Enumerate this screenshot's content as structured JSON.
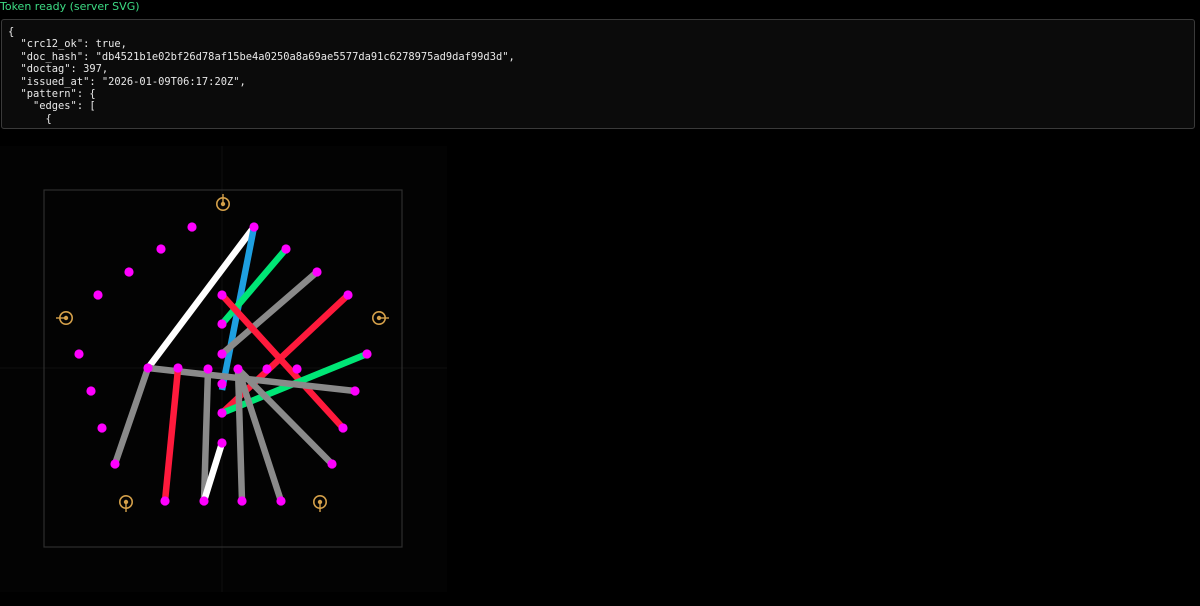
{
  "status_text": "Token ready (server SVG)",
  "token_json_lines": [
    "{",
    "  \"crc12_ok\": true,",
    "  \"doc_hash\": \"db4521b1e02bf26d78af15be4a0250a8a69ae5577da91c6278975ad9daf99d3d\",",
    "  \"doctag\": 397,",
    "  \"issued_at\": \"2026-01-09T06:17:20Z\",",
    "  \"pattern\": {",
    "    \"edges\": [",
    "      {"
  ],
  "token_svg": {
    "colors": {
      "background": "#030303",
      "frame": "#2e2e2e",
      "node": "#ff00ff",
      "anchor": "#d4a04a",
      "white": "#ffffff",
      "gray": "#8a8a8a",
      "red": "#ff1a3c",
      "green": "#00e676",
      "blue": "#1e9fe0"
    }
  }
}
